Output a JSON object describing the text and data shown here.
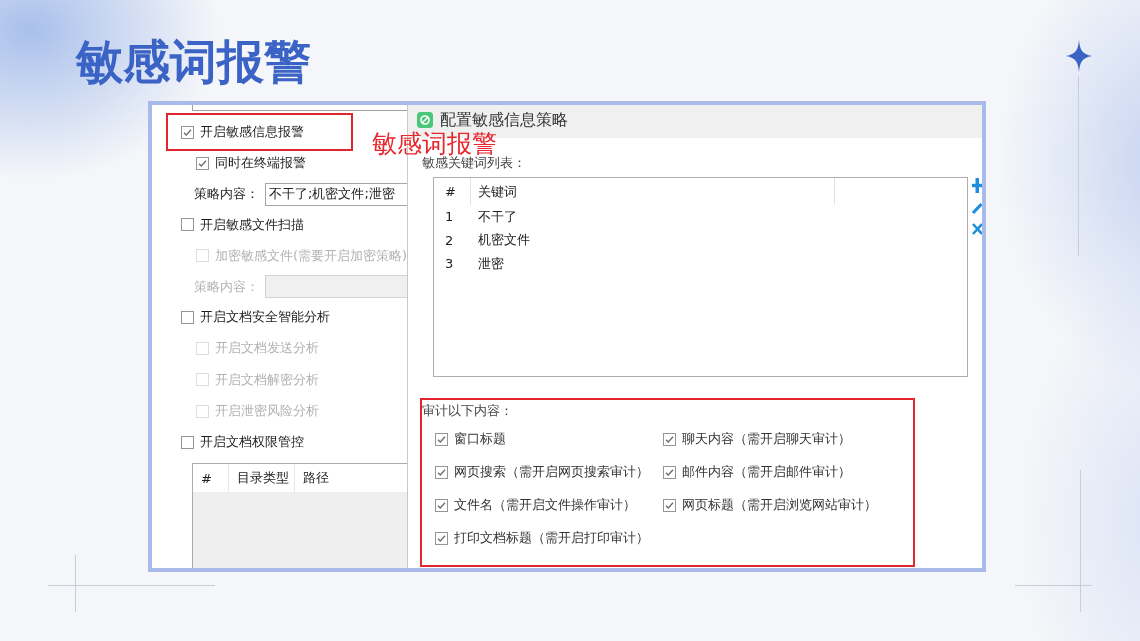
{
  "slide": {
    "title": "敏感词报警",
    "annotation": "敏感词报警"
  },
  "left_panel": {
    "options": [
      {
        "kind": "checkbox",
        "label": "开启敏感信息报警",
        "checked": true,
        "disabled": false,
        "highlighted": true,
        "children": [
          {
            "kind": "checkbox",
            "label": "同时在终端报警",
            "checked": true,
            "disabled": false
          },
          {
            "kind": "field",
            "label": "策略内容：",
            "value": "不干了;机密文件;泄密",
            "disabled": false
          }
        ]
      },
      {
        "kind": "checkbox",
        "label": "开启敏感文件扫描",
        "checked": false,
        "disabled": false,
        "highlighted": false,
        "children": [
          {
            "kind": "checkbox",
            "label": "加密敏感文件(需要开启加密策略)",
            "checked": false,
            "disabled": true
          },
          {
            "kind": "field",
            "label": "策略内容：",
            "disabled": true
          }
        ]
      },
      {
        "kind": "checkbox",
        "label": "开启文档安全智能分析",
        "checked": false,
        "disabled": false,
        "highlighted": false,
        "children": [
          {
            "kind": "checkbox",
            "label": "开启文档发送分析",
            "checked": false,
            "disabled": true
          },
          {
            "kind": "checkbox",
            "label": "开启文档解密分析",
            "checked": false,
            "disabled": true
          },
          {
            "kind": "checkbox",
            "label": "开启泄密风险分析",
            "checked": false,
            "disabled": true
          }
        ]
      },
      {
        "kind": "checkbox",
        "label": "开启文档权限管控",
        "checked": false,
        "disabled": false,
        "highlighted": false,
        "children": [
          {
            "kind": "table",
            "columns": [
              "#",
              "目录类型",
              "路径"
            ]
          }
        ]
      }
    ]
  },
  "dialog": {
    "title": "配置敏感信息策略",
    "keyword_list": {
      "label": "敏感关键词列表：",
      "columns": [
        "#",
        "关键词"
      ],
      "rows": [
        {
          "index": "1",
          "keyword": "不干了"
        },
        {
          "index": "2",
          "keyword": "机密文件"
        },
        {
          "index": "3",
          "keyword": "泄密"
        }
      ]
    },
    "audit": {
      "label": "审计以下内容：",
      "highlighted": true,
      "items": [
        {
          "label": "窗口标题",
          "checked": true
        },
        {
          "label": "聊天内容（需开启聊天审计）",
          "checked": true
        },
        {
          "label": "网页搜索（需开启网页搜索审计）",
          "checked": true
        },
        {
          "label": "邮件内容（需开启邮件审计）",
          "checked": true
        },
        {
          "label": "文件名（需开启文件操作审计）",
          "checked": true
        },
        {
          "label": "网页标题（需开启浏览网站审计）",
          "checked": true
        },
        {
          "label": "打印文档标题（需开启打印审计）",
          "checked": true
        }
      ]
    }
  }
}
